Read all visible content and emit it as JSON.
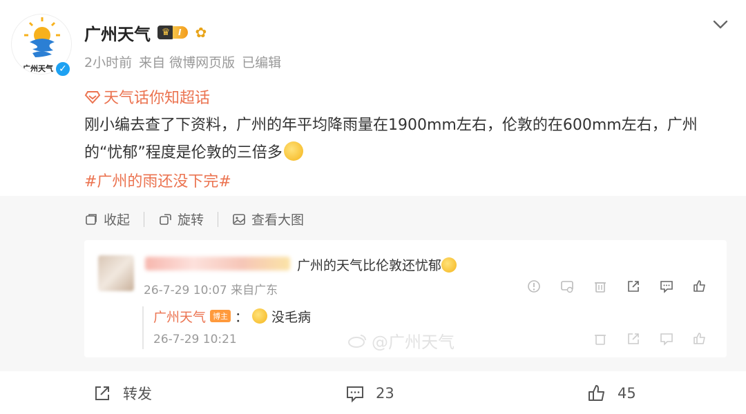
{
  "post": {
    "author_name": "广州天气",
    "avatar_caption": "广州天气",
    "vip_level": "I",
    "meta": {
      "time": "2小时前",
      "source": "来自 微博网页版",
      "edited": "已编辑"
    },
    "topic_tag": "天气话你知超话",
    "body": "刚小编去查了下资料，广州的年平均降雨量在1900mm左右，伦敦的在600mm左右，广州的“忧郁”程度是伦敦的三倍多",
    "hashtag": "#广州的雨还没下完#"
  },
  "actions": {
    "collapse": "收起",
    "rotate": "旋转",
    "view_large": "查看大图"
  },
  "comment": {
    "text": "广州的天气比伦敦还忧郁",
    "meta": "26-7-29 10:07 来自广东"
  },
  "sub_reply": {
    "author": "广州天气",
    "badge": "博主",
    "separator": "：",
    "text": "没毛病",
    "meta": "26-7-29 10:21"
  },
  "watermark": "@广州天气",
  "footer": {
    "repost_label": "转发",
    "comment_count": "23",
    "like_count": "45"
  },
  "colors": {
    "accent": "#eb7350",
    "verified": "#1da1f2",
    "text": "#333333",
    "muted": "#999999"
  }
}
